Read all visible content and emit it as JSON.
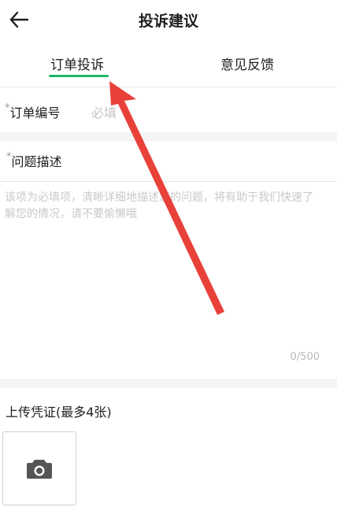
{
  "header": {
    "title": "投诉建议",
    "back_icon": "back-arrow-icon"
  },
  "tabs": [
    {
      "label": "订单投诉",
      "active": true
    },
    {
      "label": "意见反馈",
      "active": false
    }
  ],
  "form": {
    "order_number": {
      "required_mark": "*",
      "label": "订单编号",
      "placeholder": "必填"
    },
    "problem": {
      "required_mark": "*",
      "label": "问题描述",
      "placeholder": "该项为必填项，清晰详细地描述您的问题，将有助于我们快速了解您的情况，请不要偷懒哦",
      "counter": "0/500"
    },
    "upload": {
      "title": "上传凭证(最多4张)",
      "icon": "camera-icon"
    }
  },
  "colors": {
    "accent": "#1fb86a",
    "annotation_arrow": "#e8413a"
  }
}
